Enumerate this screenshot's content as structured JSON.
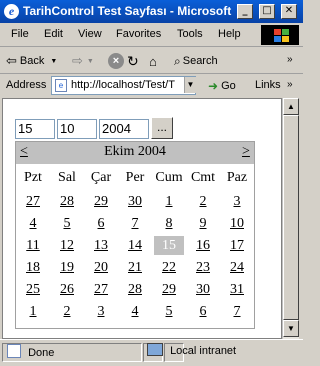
{
  "window": {
    "title": "TarihControl Test Sayfası - Microsoft ...",
    "minimize": "_",
    "maximize": "□",
    "close": "✕"
  },
  "menu": [
    "File",
    "Edit",
    "View",
    "Favorites",
    "Tools",
    "Help"
  ],
  "toolbar": {
    "back": "Back",
    "search": "Search"
  },
  "address": {
    "label": "Address",
    "url": "http://localhost/Test/T",
    "go": "Go",
    "links": "Links"
  },
  "date_inputs": {
    "day": "15",
    "month": "10",
    "year": "2004",
    "picker_button": "..."
  },
  "calendar": {
    "prev": "<",
    "next": ">",
    "caption": "Ekim 2004",
    "weekdays": [
      "Pzt",
      "Sal",
      "Çar",
      "Per",
      "Cum",
      "Cmt",
      "Paz"
    ],
    "weeks": [
      [
        "27",
        "28",
        "29",
        "30",
        "1",
        "2",
        "3"
      ],
      [
        "4",
        "5",
        "6",
        "7",
        "8",
        "9",
        "10"
      ],
      [
        "11",
        "12",
        "13",
        "14",
        "15",
        "16",
        "17"
      ],
      [
        "18",
        "19",
        "20",
        "21",
        "22",
        "23",
        "24"
      ],
      [
        "25",
        "26",
        "27",
        "28",
        "29",
        "30",
        "31"
      ],
      [
        "1",
        "2",
        "3",
        "4",
        "5",
        "6",
        "7"
      ]
    ],
    "selected": "15"
  },
  "status": {
    "text": "Done",
    "zone": "Local intranet"
  }
}
